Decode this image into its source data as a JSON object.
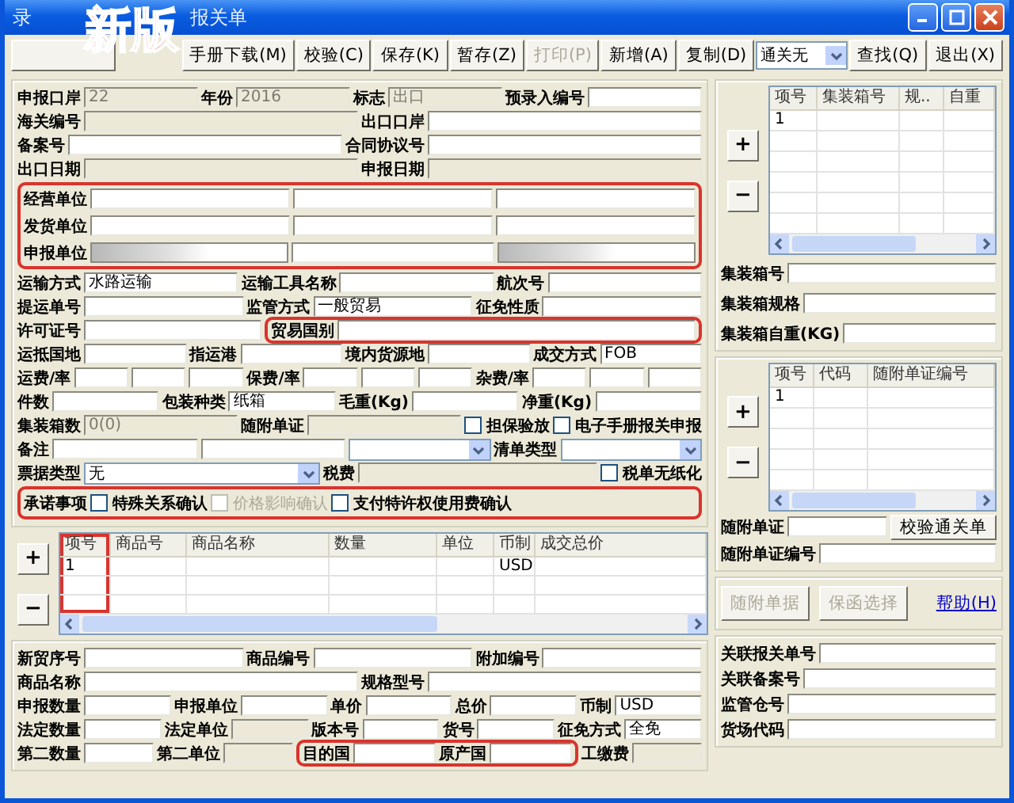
{
  "window": {
    "title_parts": [
      "录",
      "报关单"
    ],
    "badge": "新版"
  },
  "toolbar": [
    {
      "kind": "covered"
    },
    {
      "kind": "button",
      "label": "手册下载(M)",
      "disabled": false
    },
    {
      "kind": "button",
      "label": "校验(C)",
      "disabled": false
    },
    {
      "kind": "button",
      "label": "保存(K)",
      "disabled": false
    },
    {
      "kind": "button",
      "label": "暂存(Z)",
      "disabled": false
    },
    {
      "kind": "button",
      "label": "打印(P)",
      "disabled": true
    },
    {
      "kind": "button",
      "label": "新增(A)",
      "disabled": false
    },
    {
      "kind": "button",
      "label": "复制(D)",
      "disabled": false
    },
    {
      "kind": "select",
      "value": "通关无"
    },
    {
      "kind": "button",
      "label": "查找(Q)",
      "disabled": false
    },
    {
      "kind": "button",
      "label": "退出(X)",
      "disabled": false
    }
  ],
  "left_form": {
    "sections": [
      {
        "highlighted": false,
        "rows": [
          {
            "items": [
              {
                "kind": "label",
                "text": "申报口岸"
              },
              {
                "kind": "field",
                "value": "22",
                "disabled": true
              },
              {
                "kind": "label",
                "text": "年份"
              },
              {
                "kind": "field",
                "value": "2016",
                "disabled": true
              },
              {
                "kind": "label",
                "text": "标志"
              },
              {
                "kind": "field",
                "value": "出口",
                "disabled": true
              },
              {
                "kind": "label",
                "text": "预录入编号"
              },
              {
                "kind": "field",
                "disabled": false
              }
            ]
          },
          {
            "items": [
              {
                "kind": "label",
                "text": "海关编号"
              },
              {
                "kind": "field",
                "disabled": true
              },
              {
                "kind": "label",
                "text": "出口口岸"
              },
              {
                "kind": "field",
                "disabled": false
              }
            ]
          },
          {
            "items": [
              {
                "kind": "label",
                "text": "备案号"
              },
              {
                "kind": "field",
                "disabled": false
              },
              {
                "kind": "label",
                "text": "合同协议号"
              },
              {
                "kind": "field",
                "disabled": false
              }
            ]
          },
          {
            "items": [
              {
                "kind": "label",
                "text": "出口日期"
              },
              {
                "kind": "field",
                "disabled": true
              },
              {
                "kind": "label",
                "text": "申报日期"
              },
              {
                "kind": "field",
                "disabled": true
              }
            ]
          }
        ]
      },
      {
        "highlighted": true,
        "rows": [
          {
            "items": [
              {
                "kind": "label",
                "text": "经营单位"
              },
              {
                "kind": "field",
                "disabled": false
              },
              {
                "kind": "field",
                "disabled": false
              },
              {
                "kind": "field",
                "disabled": false
              }
            ]
          },
          {
            "items": [
              {
                "kind": "label",
                "text": "发货单位"
              },
              {
                "kind": "field",
                "disabled": false
              },
              {
                "kind": "field",
                "disabled": false
              },
              {
                "kind": "field",
                "disabled": false
              }
            ]
          },
          {
            "items": [
              {
                "kind": "label",
                "text": "申报单位"
              },
              {
                "kind": "blurred-field"
              },
              {
                "kind": "field",
                "disabled": false
              },
              {
                "kind": "blurred-field"
              }
            ]
          }
        ]
      },
      {
        "highlighted": false,
        "rows": [
          {
            "items": [
              {
                "kind": "label",
                "text": "运输方式"
              },
              {
                "kind": "field",
                "value": "水路运输",
                "disabled": false
              },
              {
                "kind": "label",
                "text": "运输工具名称"
              },
              {
                "kind": "field",
                "disabled": false
              },
              {
                "kind": "label",
                "text": "航次号"
              },
              {
                "kind": "field",
                "disabled": false
              }
            ]
          },
          {
            "items": [
              {
                "kind": "label",
                "text": "提运单号"
              },
              {
                "kind": "field",
                "disabled": false
              },
              {
                "kind": "label",
                "text": "监管方式"
              },
              {
                "kind": "field",
                "value": "一般贸易",
                "disabled": false
              },
              {
                "kind": "label",
                "text": "征免性质"
              },
              {
                "kind": "field",
                "disabled": false
              }
            ]
          },
          {
            "items": [
              {
                "kind": "label",
                "text": "许可证号"
              },
              {
                "kind": "field",
                "disabled": false
              },
              {
                "kind": "group",
                "highlighted": true,
                "items": [
                  {
                    "kind": "label",
                    "text": "贸易国别"
                  },
                  {
                    "kind": "field",
                    "disabled": false
                  }
                ]
              }
            ]
          },
          {
            "items": [
              {
                "kind": "label",
                "text": "运抵国地"
              },
              {
                "kind": "field",
                "disabled": false
              },
              {
                "kind": "label",
                "text": "指运港"
              },
              {
                "kind": "field",
                "disabled": false
              },
              {
                "kind": "label",
                "text": "境内货源地"
              },
              {
                "kind": "field",
                "disabled": false
              },
              {
                "kind": "label",
                "text": "成交方式"
              },
              {
                "kind": "field",
                "value": "FOB",
                "disabled": false
              }
            ]
          },
          {
            "items": [
              {
                "kind": "label",
                "text": "运费/率"
              },
              {
                "kind": "field",
                "disabled": false
              },
              {
                "kind": "field",
                "disabled": false
              },
              {
                "kind": "field",
                "disabled": false
              },
              {
                "kind": "label",
                "text": "保费/率"
              },
              {
                "kind": "field",
                "disabled": false
              },
              {
                "kind": "field",
                "disabled": false
              },
              {
                "kind": "field",
                "disabled": false
              },
              {
                "kind": "label",
                "text": "杂费/率"
              },
              {
                "kind": "field",
                "disabled": false
              },
              {
                "kind": "field",
                "disabled": false
              },
              {
                "kind": "field",
                "disabled": false
              }
            ]
          },
          {
            "items": [
              {
                "kind": "label",
                "text": "件数"
              },
              {
                "kind": "field",
                "disabled": false
              },
              {
                "kind": "label",
                "text": "包装种类"
              },
              {
                "kind": "field",
                "value": "纸箱",
                "disabled": false
              },
              {
                "kind": "label",
                "text": "毛重(Kg)"
              },
              {
                "kind": "field",
                "disabled": false
              },
              {
                "kind": "label",
                "text": "净重(Kg)"
              },
              {
                "kind": "field",
                "disabled": false
              }
            ]
          },
          {
            "items": [
              {
                "kind": "label",
                "text": "集装箱数"
              },
              {
                "kind": "field",
                "value": "0(0)",
                "disabled": true
              },
              {
                "kind": "label",
                "text": "随附单证"
              },
              {
                "kind": "field",
                "disabled": true
              },
              {
                "kind": "checkbox",
                "text": "担保验放",
                "checked": false,
                "disabled": false
              },
              {
                "kind": "checkbox",
                "text": "电子手册报关申报",
                "checked": false,
                "disabled": false
              }
            ]
          },
          {
            "items": [
              {
                "kind": "label",
                "text": "备注"
              },
              {
                "kind": "field",
                "disabled": false
              },
              {
                "kind": "field",
                "disabled": false
              },
              {
                "kind": "select"
              },
              {
                "kind": "label",
                "text": "清单类型"
              },
              {
                "kind": "select"
              }
            ]
          },
          {
            "items": [
              {
                "kind": "label",
                "text": "票据类型"
              },
              {
                "kind": "select",
                "value": "无"
              },
              {
                "kind": "label",
                "text": "税费"
              },
              {
                "kind": "field",
                "disabled": true
              },
              {
                "kind": "checkbox",
                "text": "税单无纸化",
                "checked": false,
                "disabled": false
              }
            ]
          }
        ]
      },
      {
        "highlighted": true,
        "rows": [
          {
            "items": [
              {
                "kind": "label",
                "text": "承诺事项"
              },
              {
                "kind": "checkbox",
                "text": "特殊关系确认",
                "checked": false,
                "disabled": false
              },
              {
                "kind": "checkbox",
                "text": "价格影响确认",
                "checked": false,
                "disabled": true
              },
              {
                "kind": "checkbox",
                "text": "支付特许权使用费确认",
                "checked": false,
                "disabled": false
              }
            ]
          }
        ]
      }
    ]
  },
  "goods_table": {
    "buttons": [
      "+",
      "−"
    ],
    "columns": [
      {
        "label": "项号",
        "highlighted": true
      },
      {
        "label": "商品号",
        "highlighted": false
      },
      {
        "label": "商品名称",
        "highlighted": false
      },
      {
        "label": "数量",
        "highlighted": false
      },
      {
        "label": "单位",
        "highlighted": false
      },
      {
        "label": "币制",
        "highlighted": false
      },
      {
        "label": "成交总价",
        "highlighted": false
      }
    ],
    "rows": [
      [
        "1",
        null,
        null,
        null,
        null,
        "USD",
        null
      ]
    ]
  },
  "goods_detail": {
    "rows": [
      {
        "items": [
          {
            "kind": "label",
            "text": "新贸序号"
          },
          {
            "kind": "field",
            "disabled": false
          },
          {
            "kind": "label",
            "text": "商品编号"
          },
          {
            "kind": "field",
            "disabled": false
          },
          {
            "kind": "label",
            "text": "附加编号"
          },
          {
            "kind": "field",
            "disabled": false
          }
        ]
      },
      {
        "items": [
          {
            "kind": "label",
            "text": "商品名称"
          },
          {
            "kind": "field",
            "disabled": false
          },
          {
            "kind": "label",
            "text": "规格型号"
          },
          {
            "kind": "field",
            "disabled": false
          }
        ]
      },
      {
        "items": [
          {
            "kind": "label",
            "text": "申报数量"
          },
          {
            "kind": "field",
            "disabled": false
          },
          {
            "kind": "label",
            "text": "申报单位"
          },
          {
            "kind": "field",
            "disabled": false
          },
          {
            "kind": "label",
            "text": "单价"
          },
          {
            "kind": "field",
            "disabled": false
          },
          {
            "kind": "label",
            "text": "总价"
          },
          {
            "kind": "field",
            "disabled": false
          },
          {
            "kind": "label",
            "text": "币制"
          },
          {
            "kind": "field",
            "value": "USD",
            "disabled": false
          }
        ]
      },
      {
        "items": [
          {
            "kind": "label",
            "text": "法定数量"
          },
          {
            "kind": "field",
            "disabled": false
          },
          {
            "kind": "label",
            "text": "法定单位"
          },
          {
            "kind": "field",
            "disabled": true
          },
          {
            "kind": "label",
            "text": "版本号"
          },
          {
            "kind": "field",
            "disabled": false
          },
          {
            "kind": "label",
            "text": "货号"
          },
          {
            "kind": "field",
            "disabled": false
          },
          {
            "kind": "label",
            "text": "征免方式"
          },
          {
            "kind": "field",
            "value": "全免",
            "disabled": false
          }
        ]
      },
      {
        "items": [
          {
            "kind": "label",
            "text": "第二数量"
          },
          {
            "kind": "field",
            "disabled": false
          },
          {
            "kind": "label",
            "text": "第二单位"
          },
          {
            "kind": "field",
            "disabled": true
          },
          {
            "kind": "group",
            "highlighted": true,
            "items": [
              {
                "kind": "label",
                "text": "目的国"
              },
              {
                "kind": "field",
                "disabled": false
              },
              {
                "kind": "label",
                "text": "原产国"
              },
              {
                "kind": "field",
                "disabled": false
              }
            ]
          },
          {
            "kind": "label",
            "text": "工缴费"
          },
          {
            "kind": "field",
            "disabled": true
          }
        ]
      }
    ]
  },
  "right_panel": {
    "container_table": {
      "buttons": [
        "+",
        "−"
      ],
      "columns": [
        {
          "label": "项号"
        },
        {
          "label": "集装箱号"
        },
        {
          "label": "规.."
        },
        {
          "label": "自重"
        }
      ],
      "rows": [
        [
          "1",
          null,
          null,
          null
        ]
      ]
    },
    "container_fields": [
      {
        "items": [
          {
            "kind": "label",
            "text": "集装箱号"
          },
          {
            "kind": "field",
            "disabled": false
          }
        ]
      },
      {
        "items": [
          {
            "kind": "label",
            "text": "集装箱规格"
          },
          {
            "kind": "field",
            "disabled": false
          }
        ]
      },
      {
        "items": [
          {
            "kind": "label",
            "text": "集装箱自重(KG)"
          },
          {
            "kind": "field",
            "disabled": false
          }
        ]
      }
    ],
    "docs_table": {
      "buttons": [
        "+",
        "−"
      ],
      "columns": [
        {
          "label": "项号"
        },
        {
          "label": "代码"
        },
        {
          "label": "随附单证编号"
        }
      ],
      "rows": [
        [
          "1",
          null,
          null
        ]
      ]
    },
    "doc_fields": [
      {
        "items": [
          {
            "kind": "label",
            "text": "随附单证"
          },
          {
            "kind": "field",
            "disabled": false
          },
          {
            "kind": "button",
            "label": "校验通关单",
            "disabled": false
          }
        ]
      },
      {
        "items": [
          {
            "kind": "label",
            "text": "随附单证编号"
          },
          {
            "kind": "field",
            "disabled": false
          }
        ]
      }
    ],
    "actions": [
      {
        "kind": "button",
        "label": "随附单据",
        "disabled": true
      },
      {
        "kind": "button",
        "label": "保函选择",
        "disabled": true
      },
      {
        "kind": "link",
        "label": "帮助(H)"
      }
    ],
    "related_fields": [
      {
        "items": [
          {
            "kind": "label",
            "text": "关联报关单号"
          },
          {
            "kind": "field",
            "disabled": false
          }
        ]
      },
      {
        "items": [
          {
            "kind": "label",
            "text": "关联备案号"
          },
          {
            "kind": "field",
            "disabled": false
          }
        ]
      },
      {
        "items": [
          {
            "kind": "label",
            "text": "监管仓号"
          },
          {
            "kind": "field",
            "disabled": false
          }
        ]
      },
      {
        "items": [
          {
            "kind": "label",
            "text": "货场代码"
          },
          {
            "kind": "field",
            "disabled": false
          }
        ]
      }
    ]
  }
}
